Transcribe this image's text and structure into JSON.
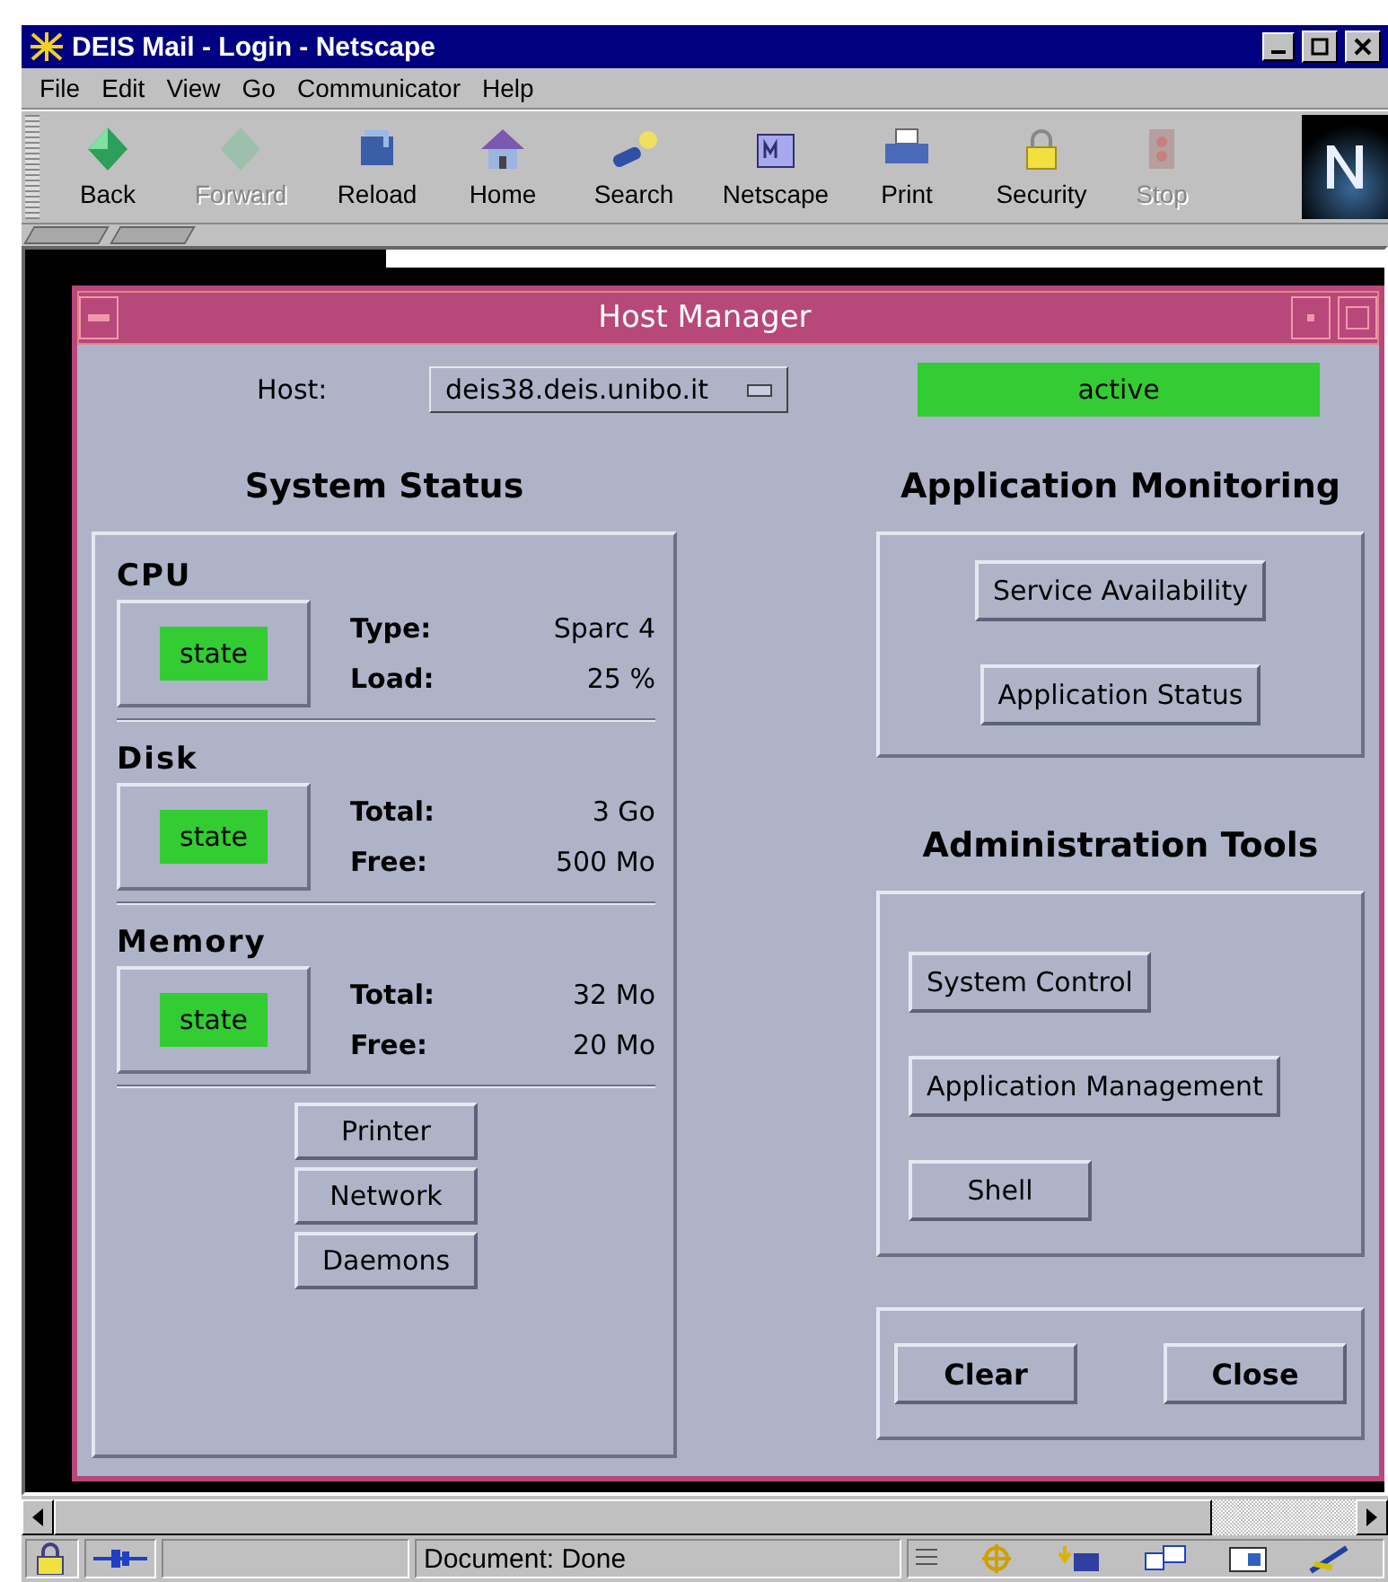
{
  "window": {
    "title": "DEIS Mail - Login - Netscape"
  },
  "menu": [
    "File",
    "Edit",
    "View",
    "Go",
    "Communicator",
    "Help"
  ],
  "toolbar": [
    {
      "label": "Back",
      "kind": "back",
      "disabled": false
    },
    {
      "label": "Forward",
      "kind": "forward",
      "disabled": true
    },
    {
      "label": "Reload",
      "kind": "reload",
      "disabled": false
    },
    {
      "label": "Home",
      "kind": "home",
      "disabled": false
    },
    {
      "label": "Search",
      "kind": "search",
      "disabled": false
    },
    {
      "label": "Netscape",
      "kind": "netscape",
      "disabled": false
    },
    {
      "label": "Print",
      "kind": "print",
      "disabled": false
    },
    {
      "label": "Security",
      "kind": "security",
      "disabled": false
    },
    {
      "label": "Stop",
      "kind": "stop",
      "disabled": true
    }
  ],
  "host_manager": {
    "title": "Host Manager",
    "host_label": "Host:",
    "host": "deis38.deis.unibo.it",
    "status": {
      "text": "active",
      "color": "#33cc33"
    },
    "system_status": {
      "heading": "System Status",
      "sections": [
        {
          "name": "CPU",
          "state": "state",
          "color": "#33cc33",
          "details": [
            {
              "label": "Type:",
              "value": "Sparc 4"
            },
            {
              "label": "Load:",
              "value": "25 %"
            }
          ]
        },
        {
          "name": "Disk",
          "state": "state",
          "color": "#33cc33",
          "details": [
            {
              "label": "Total:",
              "value": "3 Go"
            },
            {
              "label": "Free:",
              "value": "500 Mo"
            }
          ]
        },
        {
          "name": "Memory",
          "state": "state",
          "color": "#33cc33",
          "details": [
            {
              "label": "Total:",
              "value": "32 Mo"
            },
            {
              "label": "Free:",
              "value": "20 Mo"
            }
          ]
        }
      ],
      "buttons": [
        "Printer",
        "Network",
        "Daemons"
      ]
    },
    "application_monitoring": {
      "heading": "Application Monitoring",
      "buttons": [
        "Service Availability",
        "Application Status"
      ]
    },
    "administration_tools": {
      "heading": "Administration Tools",
      "buttons": [
        "System Control",
        "Application Management",
        "Shell"
      ]
    },
    "actions": [
      "Clear",
      "Close"
    ]
  },
  "status_bar": {
    "text": "Document: Done"
  }
}
